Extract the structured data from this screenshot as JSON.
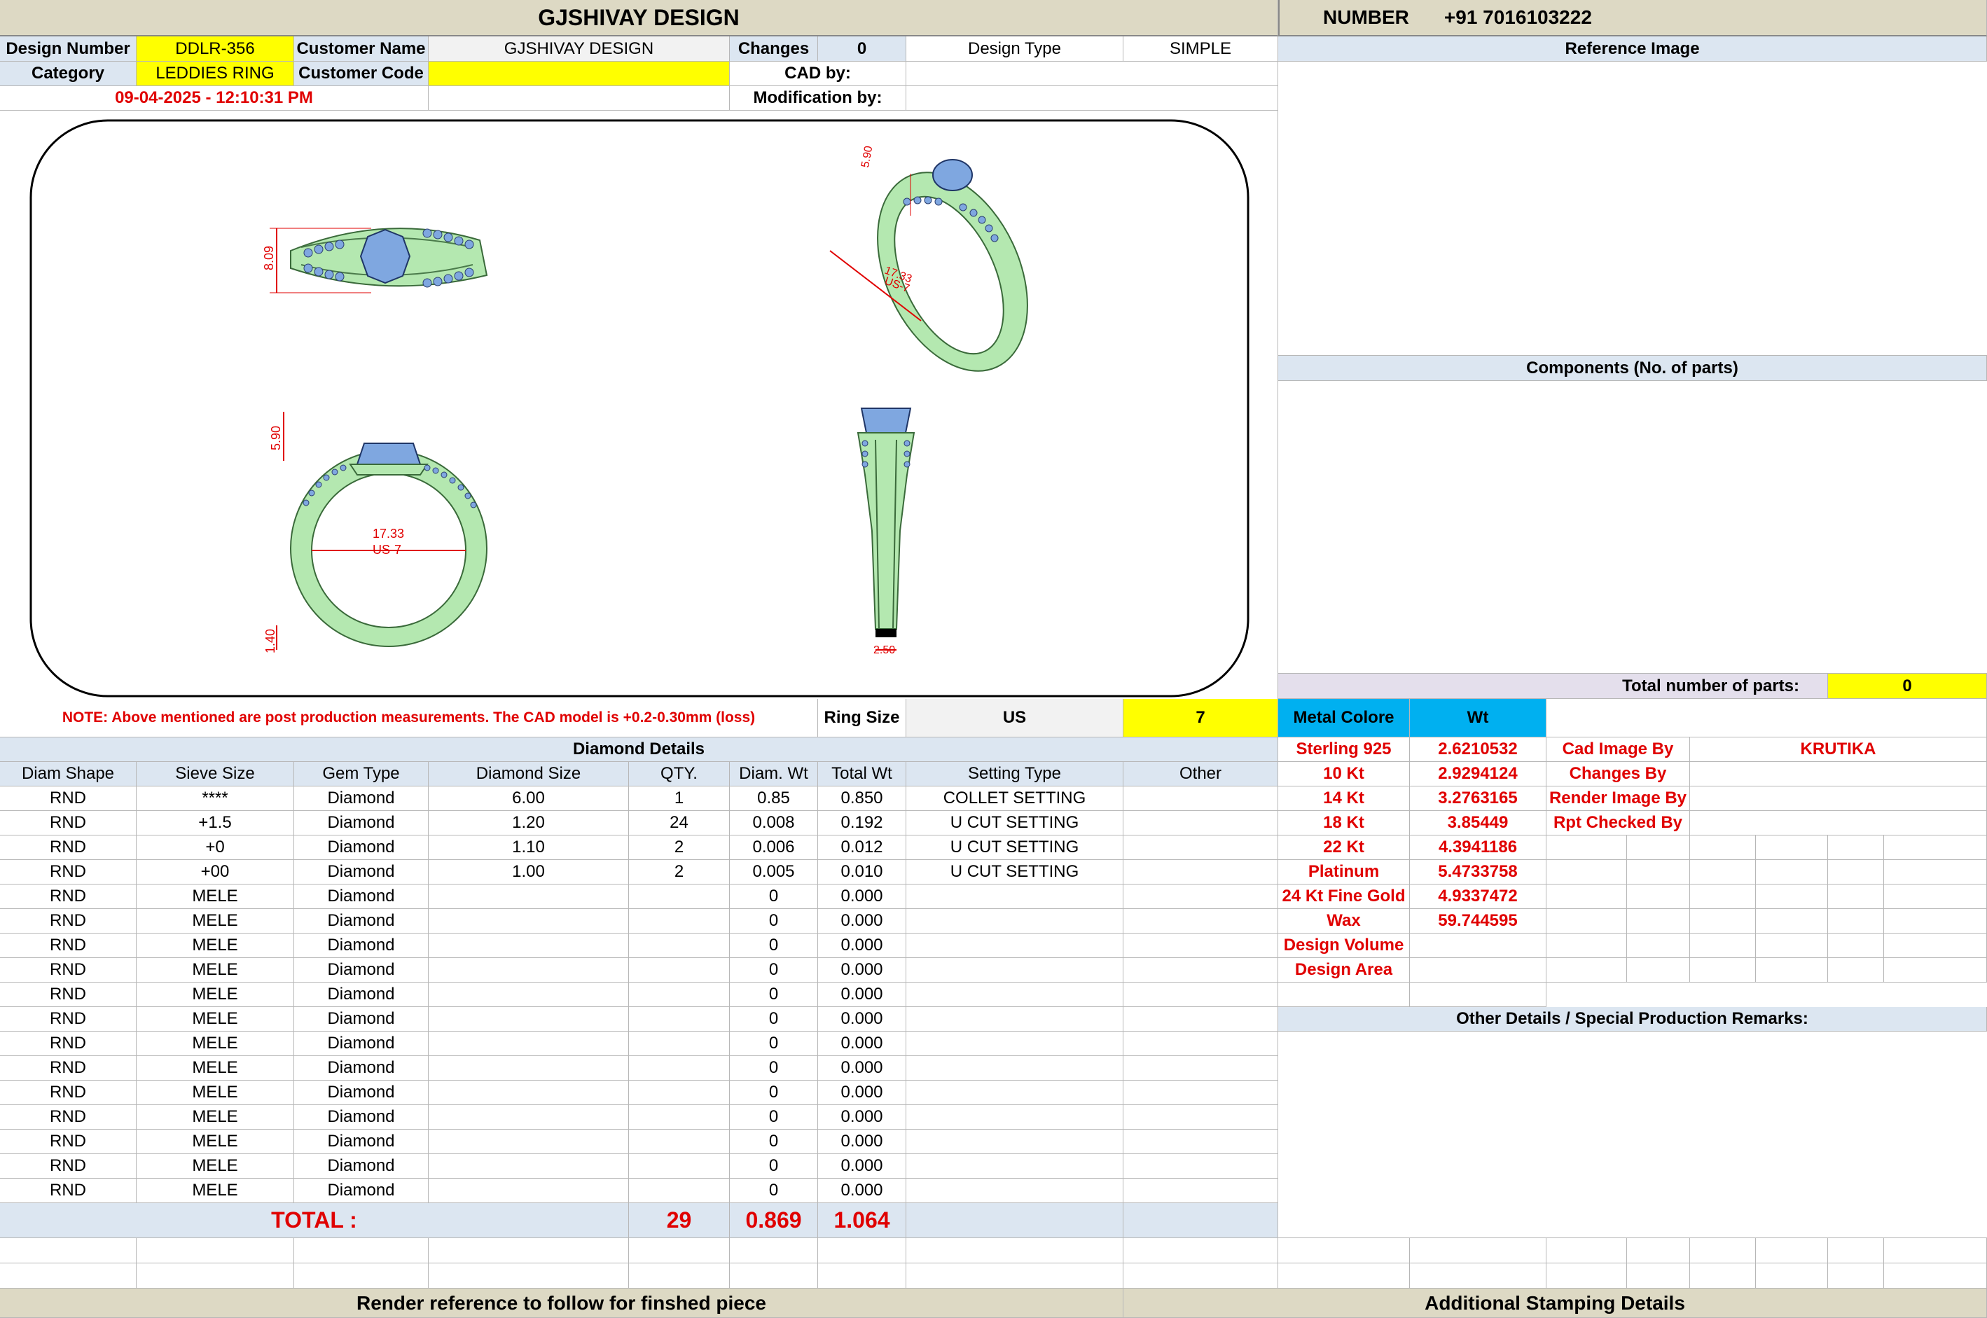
{
  "header": {
    "company": "GJSHIVAY DESIGN",
    "number_label": "NUMBER",
    "number": "+91 7016103222"
  },
  "info": {
    "design_number_label": "Design Number",
    "design_number": "DDLR-356",
    "customer_name_label": "Customer Name",
    "customer_name": "GJSHIVAY DESIGN",
    "changes_label": "Changes",
    "changes": "0",
    "design_type_label": "Design Type",
    "design_type": "SIMPLE",
    "category_label": "Category",
    "category": "LEDDIES RING",
    "customer_code_label": "Customer Code",
    "cad_by_label": "CAD by:",
    "modification_by_label": "Modification by:",
    "datetime": "09-04-2025 - 12:10:31 PM"
  },
  "ring": {
    "top_height": "8.09",
    "angle_height": "5.90",
    "angle_size": "17.33",
    "angle_us": "US-7",
    "front_height": "5.90",
    "front_size": "17.33",
    "front_us": "US-7",
    "front_bottom": "1.40",
    "side_width": "2.50"
  },
  "note": "NOTE: Above mentioned are post production measurements. The CAD model is +0.2-0.30mm (loss)",
  "ring_size": {
    "label": "Ring Size",
    "unit": "US",
    "value": "7"
  },
  "diamond": {
    "title": "Diamond Details",
    "headers": [
      "Diam Shape",
      "Sieve Size",
      "Gem Type",
      "Diamond Size",
      "QTY.",
      "Diam. Wt",
      "Total Wt",
      "Setting Type",
      "Other"
    ],
    "rows": [
      [
        "RND",
        "****",
        "Diamond",
        "6.00",
        "1",
        "0.85",
        "0.850",
        "COLLET SETTING",
        ""
      ],
      [
        "RND",
        "+1.5",
        "Diamond",
        "1.20",
        "24",
        "0.008",
        "0.192",
        "U CUT SETTING",
        ""
      ],
      [
        "RND",
        "+0",
        "Diamond",
        "1.10",
        "2",
        "0.006",
        "0.012",
        "U CUT SETTING",
        ""
      ],
      [
        "RND",
        "+00",
        "Diamond",
        "1.00",
        "2",
        "0.005",
        "0.010",
        "U CUT SETTING",
        ""
      ],
      [
        "RND",
        "MELE",
        "Diamond",
        "",
        "",
        "0",
        "0.000",
        "",
        ""
      ],
      [
        "RND",
        "MELE",
        "Diamond",
        "",
        "",
        "0",
        "0.000",
        "",
        ""
      ],
      [
        "RND",
        "MELE",
        "Diamond",
        "",
        "",
        "0",
        "0.000",
        "",
        ""
      ],
      [
        "RND",
        "MELE",
        "Diamond",
        "",
        "",
        "0",
        "0.000",
        "",
        ""
      ],
      [
        "RND",
        "MELE",
        "Diamond",
        "",
        "",
        "0",
        "0.000",
        "",
        ""
      ],
      [
        "RND",
        "MELE",
        "Diamond",
        "",
        "",
        "0",
        "0.000",
        "",
        ""
      ],
      [
        "RND",
        "MELE",
        "Diamond",
        "",
        "",
        "0",
        "0.000",
        "",
        ""
      ],
      [
        "RND",
        "MELE",
        "Diamond",
        "",
        "",
        "0",
        "0.000",
        "",
        ""
      ],
      [
        "RND",
        "MELE",
        "Diamond",
        "",
        "",
        "0",
        "0.000",
        "",
        ""
      ],
      [
        "RND",
        "MELE",
        "Diamond",
        "",
        "",
        "0",
        "0.000",
        "",
        ""
      ],
      [
        "RND",
        "MELE",
        "Diamond",
        "",
        "",
        "0",
        "0.000",
        "",
        ""
      ],
      [
        "RND",
        "MELE",
        "Diamond",
        "",
        "",
        "0",
        "0.000",
        "",
        ""
      ],
      [
        "RND",
        "MELE",
        "Diamond",
        "",
        "",
        "0",
        "0.000",
        "",
        ""
      ]
    ],
    "total_label": "TOTAL :",
    "total_qty": "29",
    "total_diam_wt": "0.869",
    "total_wt": "1.064"
  },
  "right": {
    "reference_image": "Reference Image",
    "components": "Components (No. of parts)",
    "total_parts_label": "Total number of parts:",
    "total_parts": "0",
    "metal_label": "Metal Colore",
    "wt_label": "Wt",
    "metals": [
      {
        "name": "Sterling 925",
        "wt": "2.6210532"
      },
      {
        "name": "10 Kt",
        "wt": "2.9294124"
      },
      {
        "name": "14 Kt",
        "wt": "3.2763165"
      },
      {
        "name": "18 Kt",
        "wt": "3.85449"
      },
      {
        "name": "22 Kt",
        "wt": "4.3941186"
      },
      {
        "name": "Platinum",
        "wt": "5.4733758"
      },
      {
        "name": "24 Kt Fine Gold",
        "wt": "4.9337472"
      },
      {
        "name": "Wax",
        "wt": "59.744595"
      },
      {
        "name": "Design Volume",
        "wt": ""
      },
      {
        "name": "Design Area",
        "wt": ""
      }
    ],
    "roles": [
      {
        "label": "Cad Image By",
        "value": "KRUTIKA"
      },
      {
        "label": "Changes By",
        "value": ""
      },
      {
        "label": "Render Image By",
        "value": ""
      },
      {
        "label": "Rpt Checked By",
        "value": ""
      }
    ],
    "other_details": "Other Details / Special Production Remarks:"
  },
  "footer": {
    "left": "Render reference to follow for finshed piece",
    "right": "Additional Stamping Details"
  },
  "colors": {
    "ring_metal": "#b4e8b0",
    "gem": "#7fa7e0",
    "dim_red": "#e00000",
    "header_tan": "#ddd9c4",
    "light_blue": "#dce6f1",
    "yellow": "#ffff00",
    "cyan": "#00b0f0"
  }
}
